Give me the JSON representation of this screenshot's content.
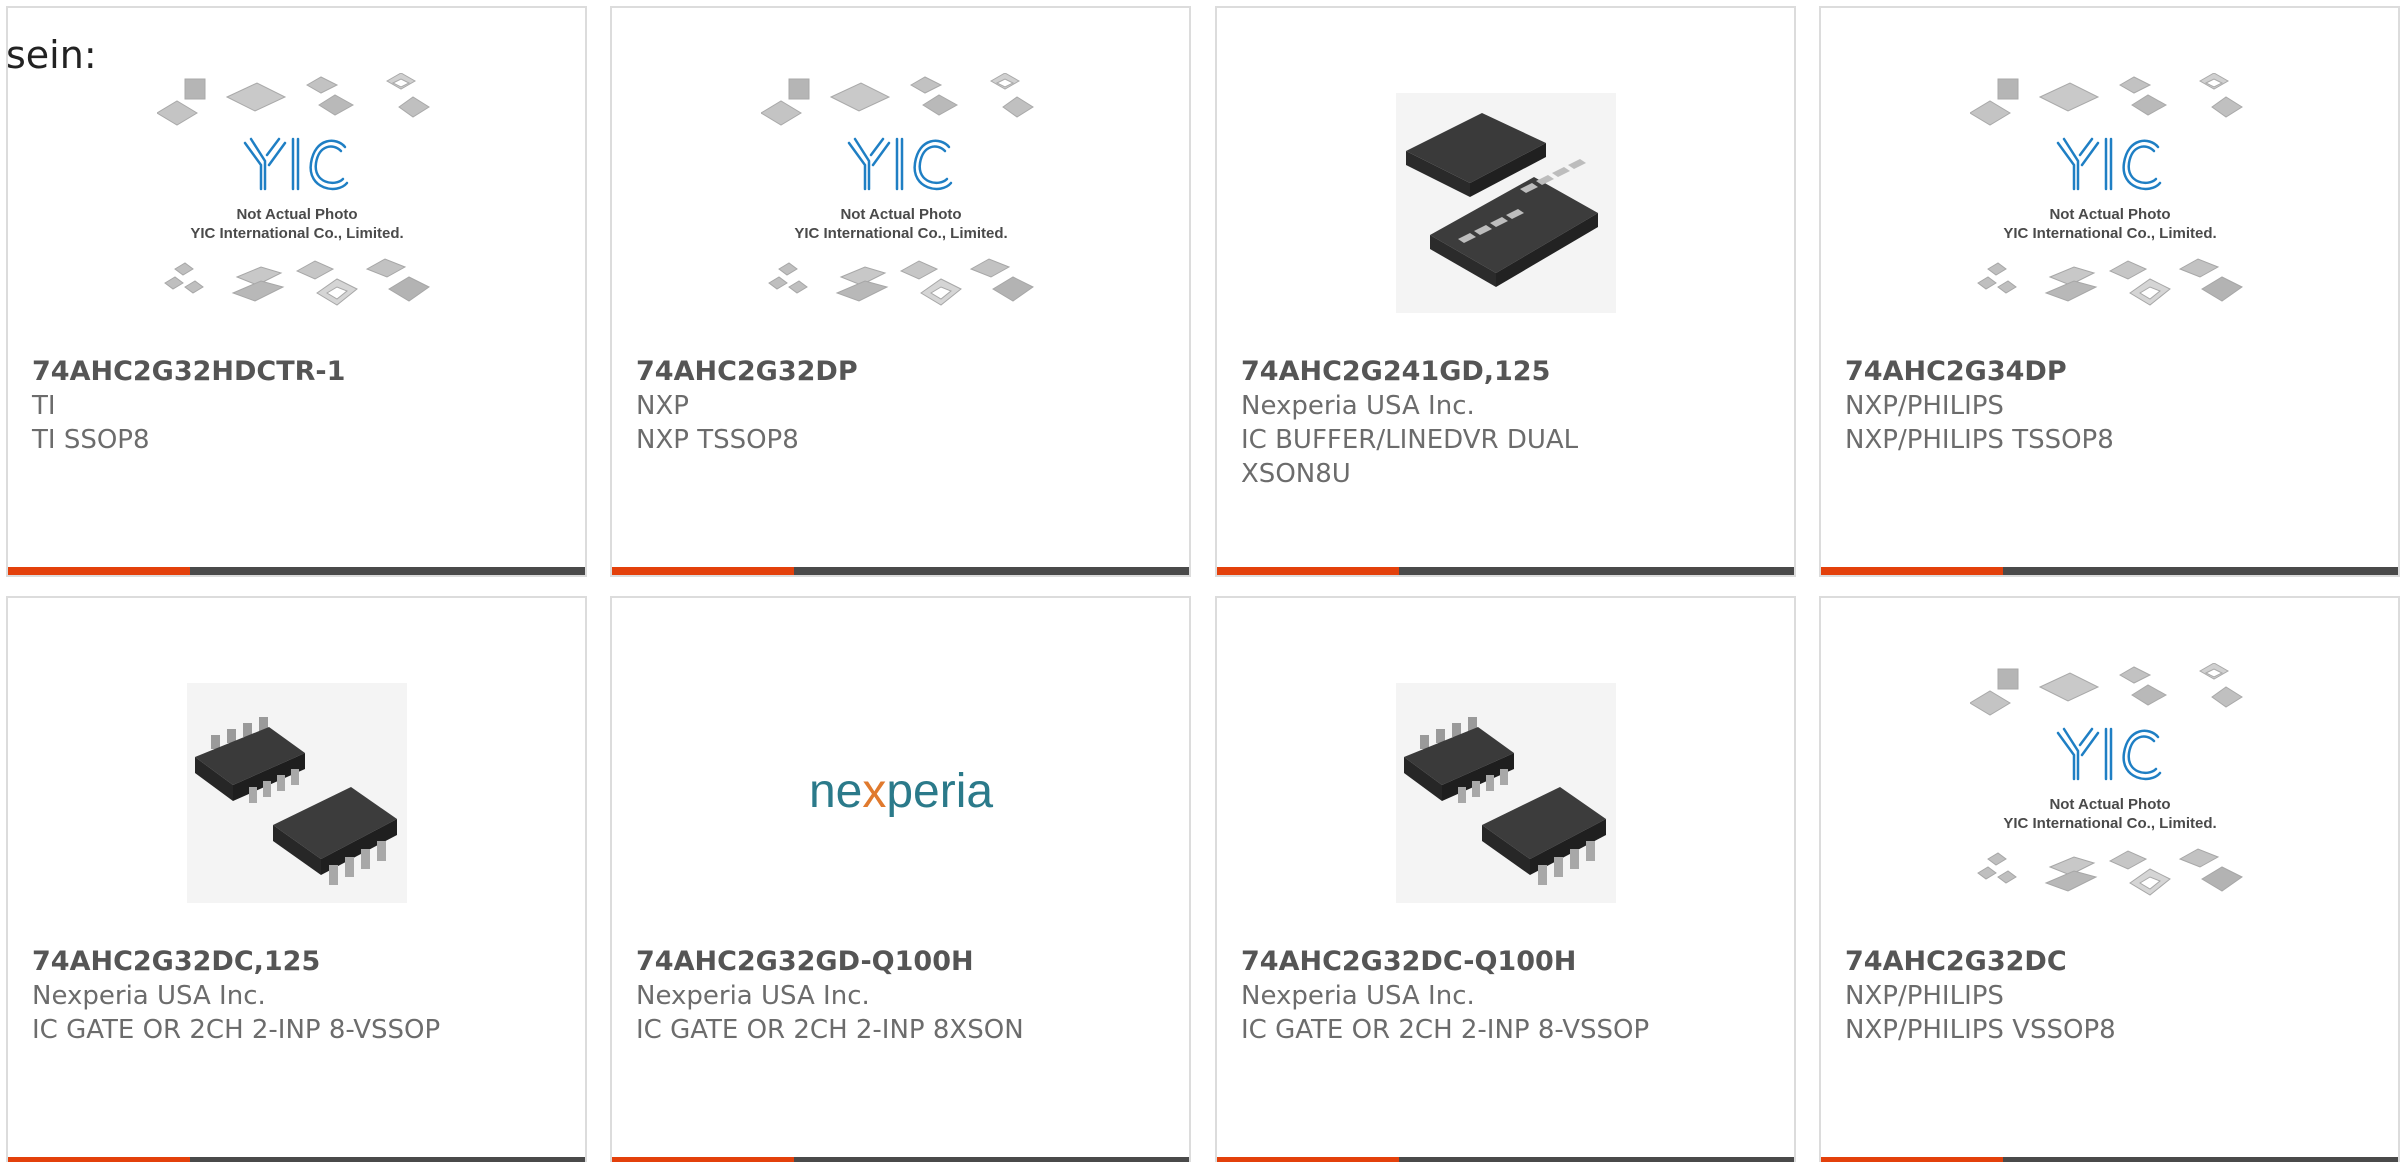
{
  "page": {
    "heading_fragment": "sein:"
  },
  "colors": {
    "accent_bar": "#e3400b",
    "bar_dark": "#4a4a4a",
    "card_border": "#dcdcdc",
    "part_text": "#555555",
    "meta_text": "#6c6c6c",
    "yic_logo_blue": "#1f7fc4",
    "nexperia_teal": "#2b7a8a",
    "nexperia_orange": "#e07a2e"
  },
  "placeholder_image": {
    "line1": "Not Actual Photo",
    "line2": "YIC International Co., Limited."
  },
  "nexperia_logo": {
    "text_before": "ne",
    "text_x": "x",
    "text_after": "peria"
  },
  "products": [
    {
      "part": "74AHC2G32HDCTR-1",
      "manufacturer": "TI",
      "description": "TI SSOP8",
      "image": "yic-placeholder-icon"
    },
    {
      "part": "74AHC2G32DP",
      "manufacturer": "NXP",
      "description": "NXP TSSOP8",
      "image": "yic-placeholder-icon"
    },
    {
      "part": "74AHC2G241GD,125",
      "manufacturer": "Nexperia USA Inc.",
      "description": "IC BUFFER/LINEDVR DUAL XSON8U",
      "image": "xson-chip-icon"
    },
    {
      "part": "74AHC2G34DP",
      "manufacturer": "NXP/PHILIPS",
      "description": "NXP/PHILIPS TSSOP8",
      "image": "yic-placeholder-icon"
    },
    {
      "part": "74AHC2G32DC,125",
      "manufacturer": "Nexperia USA Inc.",
      "description": "IC GATE OR 2CH 2-INP 8-VSSOP",
      "image": "vssop-chip-icon"
    },
    {
      "part": "74AHC2G32GD-Q100H",
      "manufacturer": "Nexperia USA Inc.",
      "description": "IC GATE OR 2CH 2-INP 8XSON",
      "image": "nexperia-logo"
    },
    {
      "part": "74AHC2G32DC-Q100H",
      "manufacturer": "Nexperia USA Inc.",
      "description": "IC GATE OR 2CH 2-INP 8-VSSOP",
      "image": "vssop-chip-icon"
    },
    {
      "part": "74AHC2G32DC",
      "manufacturer": "NXP/PHILIPS",
      "description": "NXP/PHILIPS VSSOP8",
      "image": "yic-placeholder-icon"
    }
  ]
}
